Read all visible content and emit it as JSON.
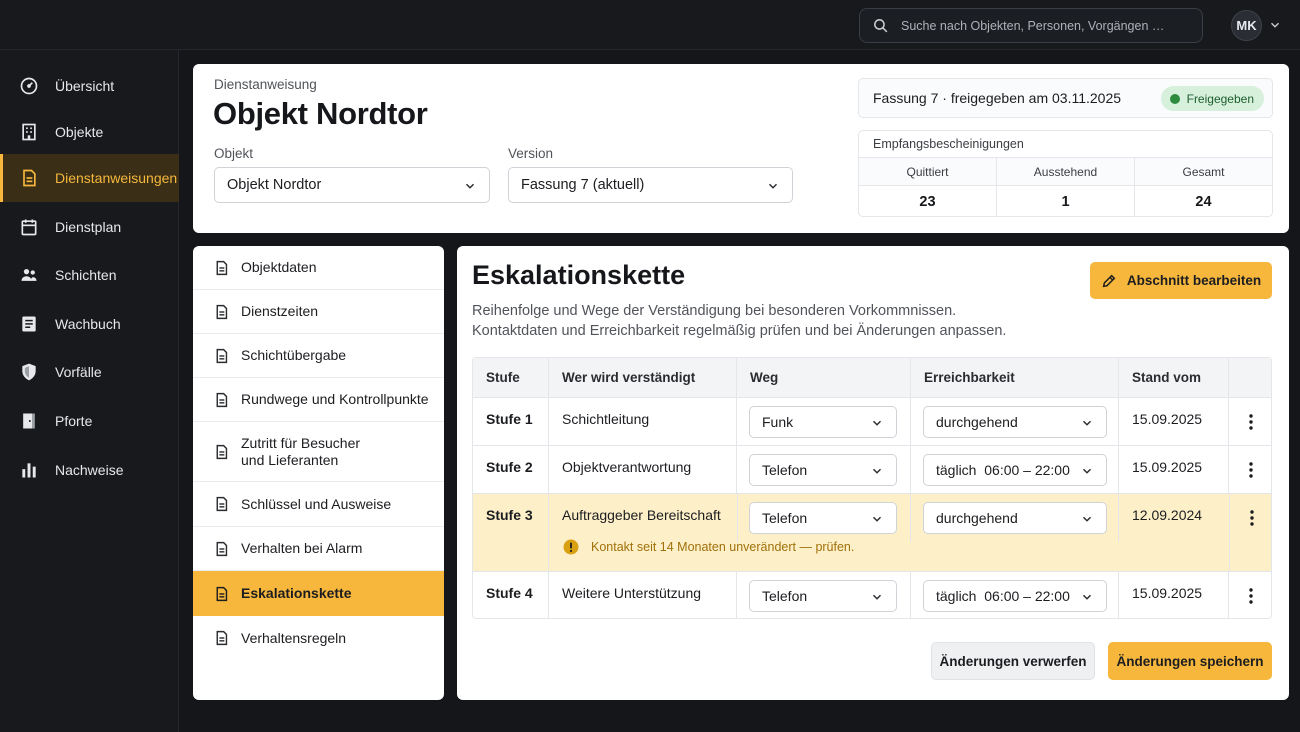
{
  "topbar": {
    "search_placeholder": "Suche nach Objekten, Personen, Vorgängen …",
    "user_initials": "MK"
  },
  "sidebar": {
    "items": [
      {
        "label": "Übersicht",
        "icon": "dashboard-icon"
      },
      {
        "label": "Objekte",
        "icon": "building-icon"
      },
      {
        "label": "Dienstanweisungen",
        "icon": "document-icon",
        "active": true
      },
      {
        "label": "Dienstplan",
        "icon": "calendar-icon"
      },
      {
        "label": "Schichten",
        "icon": "people-icon"
      },
      {
        "label": "Wachbuch",
        "icon": "book-icon"
      },
      {
        "label": "Vorfälle",
        "icon": "shield-icon"
      },
      {
        "label": "Pforte",
        "icon": "door-icon"
      },
      {
        "label": "Nachweise",
        "icon": "bar-chart-icon"
      }
    ]
  },
  "header": {
    "kicker": "Dienstanweisung",
    "title": "Objekt Nordtor",
    "object_label": "Objekt",
    "object_value": "Objekt Nordtor",
    "version_label": "Version",
    "version_value": "Fassung 7 (aktuell)",
    "version_info": "Fassung 7 · freigegeben am 03.11.2025",
    "status": "Freigegeben",
    "receipts": {
      "title": "Empfangsbescheinigungen",
      "columns": [
        {
          "label": "Quittiert",
          "value": "23"
        },
        {
          "label": "Ausstehend",
          "value": "1"
        },
        {
          "label": "Gesamt",
          "value": "24"
        }
      ]
    }
  },
  "sections": [
    {
      "label": "Objektdaten"
    },
    {
      "label": "Dienstzeiten"
    },
    {
      "label": "Schichtübergabe"
    },
    {
      "label": "Rundwege und Kontrollpunkte"
    },
    {
      "label": "Zutritt für Besucher\nund Lieferanten"
    },
    {
      "label": "Schlüssel und Ausweise"
    },
    {
      "label": "Verhalten bei Alarm"
    },
    {
      "label": "Eskalationskette",
      "active": true
    },
    {
      "label": "Verhaltensregeln"
    }
  ],
  "main": {
    "title": "Eskalationskette",
    "desc_line1": "Reihenfolge und Wege der Verständigung bei besonderen Vorkommnissen.",
    "desc_line2": "Kontaktdaten und Erreichbarkeit regelmäßig prüfen und bei Änderungen anpassen.",
    "edit_label": "Abschnitt bearbeiten",
    "table": {
      "headers": [
        "Stufe",
        "Wer wird verständigt",
        "Weg",
        "Erreichbarkeit",
        "Stand vom",
        ""
      ],
      "rows": [
        {
          "stufe": "Stufe 1",
          "wer": "Schichtleitung",
          "weg": "Funk",
          "erreichbarkeit": "durchgehend",
          "stand": "15.09.2025"
        },
        {
          "stufe": "Stufe 2",
          "wer": "Objektverantwortung",
          "weg": "Telefon",
          "erreichbarkeit": "täglich  06:00 – 22:00",
          "stand": "15.09.2025"
        },
        {
          "stufe": "Stufe 3",
          "wer": "Auftraggeber Bereitschaft",
          "weg": "Telefon",
          "erreichbarkeit": "durchgehend",
          "stand": "12.09.2024",
          "warning": "Kontakt seit 14 Monaten unverändert — prüfen."
        },
        {
          "stufe": "Stufe 4",
          "wer": "Weitere Unterstützung",
          "weg": "Telefon",
          "erreichbarkeit": "täglich  06:00 – 22:00",
          "stand": "15.09.2025"
        }
      ]
    },
    "discard_label": "Änderungen verwerfen",
    "save_label": "Änderungen speichern"
  },
  "colors": {
    "accent": "#f6b73c",
    "warning_bg": "#fdf0c8",
    "status_green": "#2e8b3e"
  }
}
